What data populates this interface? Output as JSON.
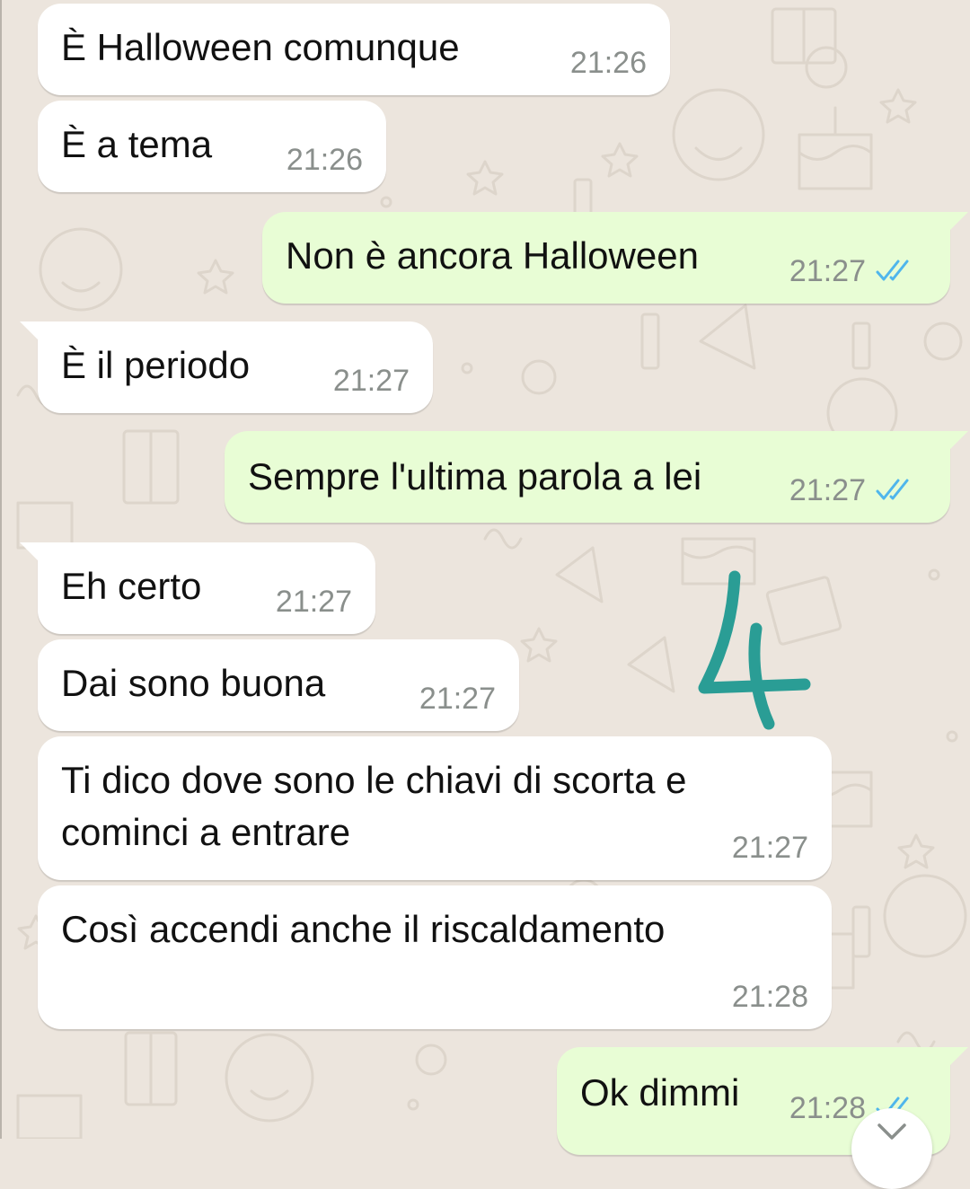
{
  "messages": [
    {
      "direction": "in",
      "text": "È Halloween comunque",
      "time": "21:26"
    },
    {
      "direction": "in",
      "text": "È a tema",
      "time": "21:26"
    },
    {
      "direction": "out",
      "text": "Non è ancora Halloween",
      "time": "21:27",
      "status": "read"
    },
    {
      "direction": "in",
      "text": "È il periodo",
      "time": "21:27"
    },
    {
      "direction": "out",
      "text": "Sempre l'ultima parola a lei",
      "time": "21:27",
      "status": "read"
    },
    {
      "direction": "in",
      "text": "Eh certo",
      "time": "21:27"
    },
    {
      "direction": "in",
      "text": "Dai sono buona",
      "time": "21:27"
    },
    {
      "direction": "in",
      "text": "Ti dico dove sono le chiavi di scorta e\ncominci a entrare",
      "time": "21:27"
    },
    {
      "direction": "in",
      "text": "Così accendi anche il riscaldamento",
      "time": "21:28"
    },
    {
      "direction": "out",
      "text": "Ok dimmi",
      "time": "21:28",
      "status": "read"
    }
  ],
  "annotation": {
    "text": "4",
    "color": "#2a9d95"
  },
  "colors": {
    "incoming_bubble": "#ffffff",
    "outgoing_bubble": "#e8fdd5",
    "read_ticks": "#4fb6ec",
    "wallpaper": "#ece5dd"
  }
}
